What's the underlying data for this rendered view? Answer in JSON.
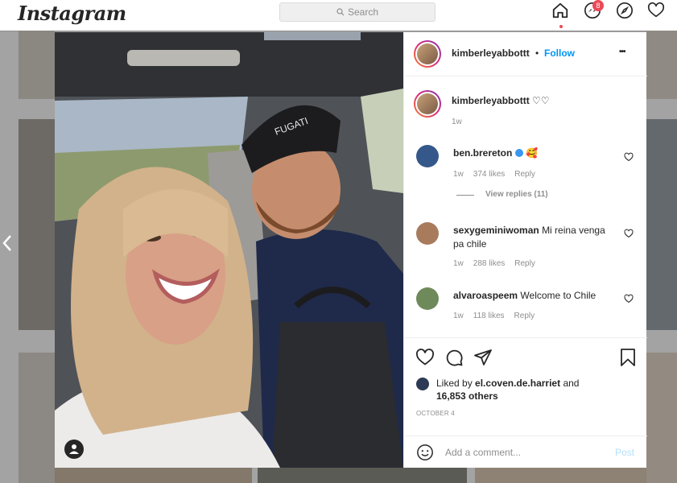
{
  "nav": {
    "logo": "Instagram",
    "search_placeholder": "Search",
    "messages_badge": "8",
    "icons": [
      "home-icon",
      "messenger-icon",
      "explore-icon",
      "activity-heart-icon"
    ]
  },
  "post": {
    "username": "kimberleyabbottt",
    "follow_separator": "•",
    "follow_label": "Follow",
    "more_label": "•••",
    "caption_user": "kimberleyabbottt",
    "caption_text": "♡♡",
    "caption_time": "1w",
    "comments": [
      {
        "user": "ben.brereton",
        "text": "🥰",
        "verified": true,
        "time": "1w",
        "likes": "374 likes",
        "reply": "Reply",
        "view_replies": "View replies (11)"
      },
      {
        "user": "sexygeminiwoman",
        "text": "Mi reina venga pa chile",
        "time": "1w",
        "likes": "288 likes",
        "reply": "Reply"
      },
      {
        "user": "alvaroaspeem",
        "text": "Welcome to Chile",
        "time": "1w",
        "likes": "118 likes",
        "reply": "Reply"
      }
    ],
    "liked_by_prefix": "Liked by",
    "liked_by_user": "el.coven.de.harriet",
    "liked_by_and": "and",
    "liked_by_others": "16,853 others",
    "date": "OCTOBER 4",
    "add_comment_placeholder": "Add a comment...",
    "post_button": "Post",
    "photo_cap_text": "FUGATI"
  },
  "colors": {
    "accent": "#0095f6",
    "badge": "#ed4956"
  }
}
